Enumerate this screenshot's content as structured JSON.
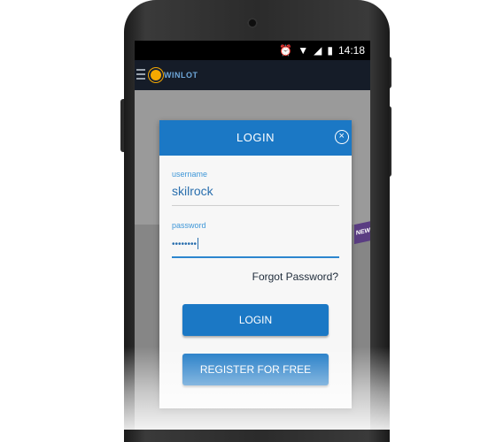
{
  "statusbar": {
    "time": "14:18",
    "icons": [
      "alarm-icon",
      "wifi-icon",
      "signal-icon",
      "battery-icon"
    ]
  },
  "appbar": {
    "logo_text": "WINLOT"
  },
  "banner": {
    "new_label": "NEW"
  },
  "dialog": {
    "title": "LOGIN",
    "close_symbol": "×",
    "username_label": "username",
    "username_value": "skilrock",
    "password_label": "password",
    "password_value": "••••••••",
    "forgot_label": "Forgot Password?",
    "login_button": "LOGIN",
    "register_button": "REGISTER FOR FREE"
  },
  "colors": {
    "primary": "#1b78c5",
    "appbar": "#151c28",
    "dialog_bg": "#f7f7f7"
  }
}
